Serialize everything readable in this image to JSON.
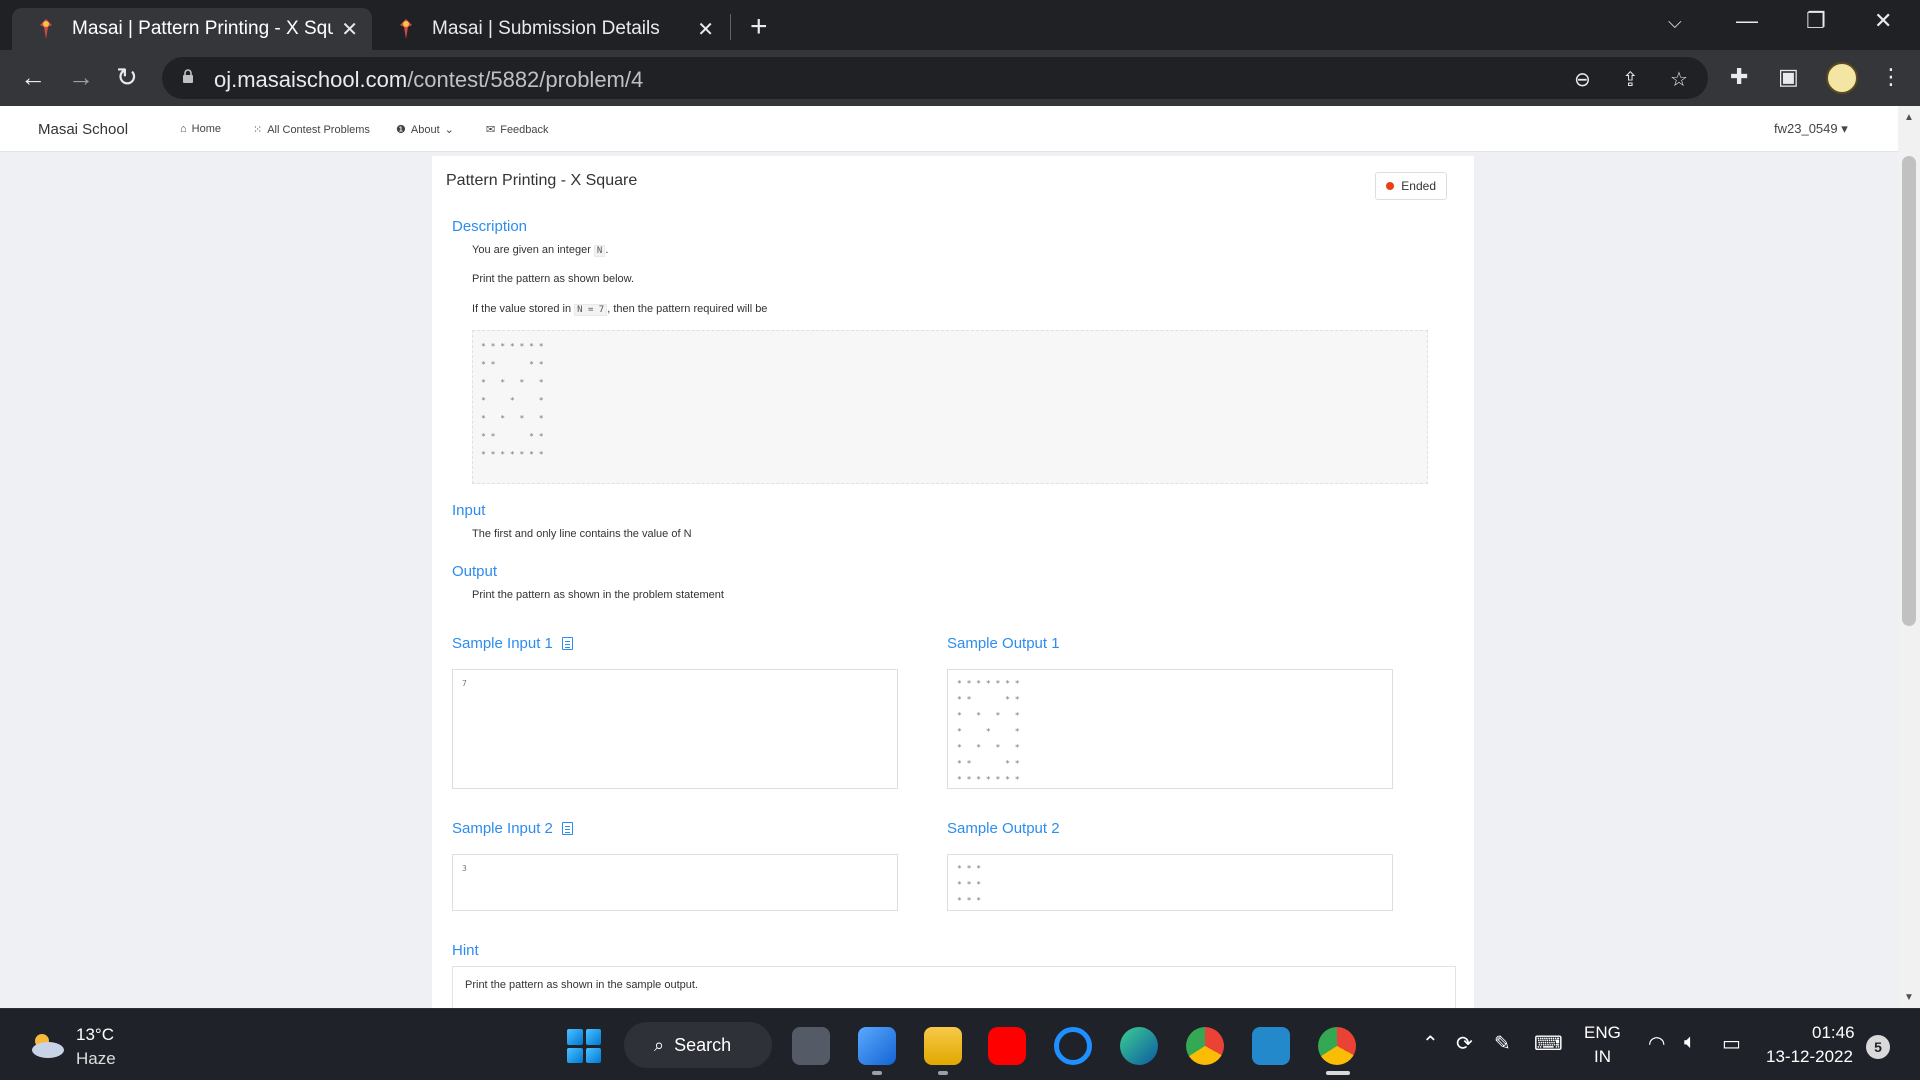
{
  "browser": {
    "tabs": [
      {
        "title": "Masai | Pattern Printing - X Squar",
        "active": true
      },
      {
        "title": "Masai | Submission Details",
        "active": false
      }
    ],
    "url_host": "oj.masaischool.com",
    "url_path": "/contest/5882/problem/4"
  },
  "nav": {
    "brand": "Masai School",
    "links": [
      "Home",
      "All Contest Problems",
      "About",
      "Feedback"
    ],
    "user": "fw23_0549"
  },
  "problem": {
    "title": "Pattern Printing - X Square",
    "status": "Ended",
    "description_heading": "Description",
    "desc_line1_pre": "You are given an integer",
    "desc_line1_code": "N",
    "desc_line1_post": ".",
    "desc_line2": "Print the pattern as shown below.",
    "desc_line3_pre": "If the value stored in",
    "desc_line3_code": "N = 7",
    "desc_line3_post": ", then the pattern required will be",
    "pattern": "* * * * * * *\n* *       * *\n*   *   *   *\n*     *     *\n*   *   *   *\n* *       * *\n* * * * * * *",
    "input_heading": "Input",
    "input_text": "The first and only line contains the value of N",
    "output_heading": "Output",
    "output_text": "Print the pattern as shown in the problem statement",
    "sample_input_1_heading": "Sample Input 1",
    "sample_input_1": "7",
    "sample_output_1_heading": "Sample Output 1",
    "sample_output_1": "* * * * * * *\n* *       * *\n*   *   *   *\n*     *     *\n*   *   *   *\n* *       * *\n* * * * * * *",
    "sample_input_2_heading": "Sample Input 2",
    "sample_input_2": "3",
    "sample_output_2_heading": "Sample Output 2",
    "sample_output_2": "* * *\n* * *\n* * *",
    "hint_heading": "Hint",
    "hint_text": "Print the pattern as shown in the sample output."
  },
  "taskbar": {
    "temp": "13°C",
    "weather": "Haze",
    "search_label": "Search",
    "lang_1": "ENG",
    "lang_2": "IN",
    "time": "01:46",
    "date": "13-12-2022",
    "notifications": "5"
  },
  "colors": {
    "accent": "#2d8cf0",
    "status_dot": "#ed3f14",
    "chrome_dark": "#202124",
    "chrome_toolbar": "#35363a",
    "taskbar": "#1f2228"
  }
}
